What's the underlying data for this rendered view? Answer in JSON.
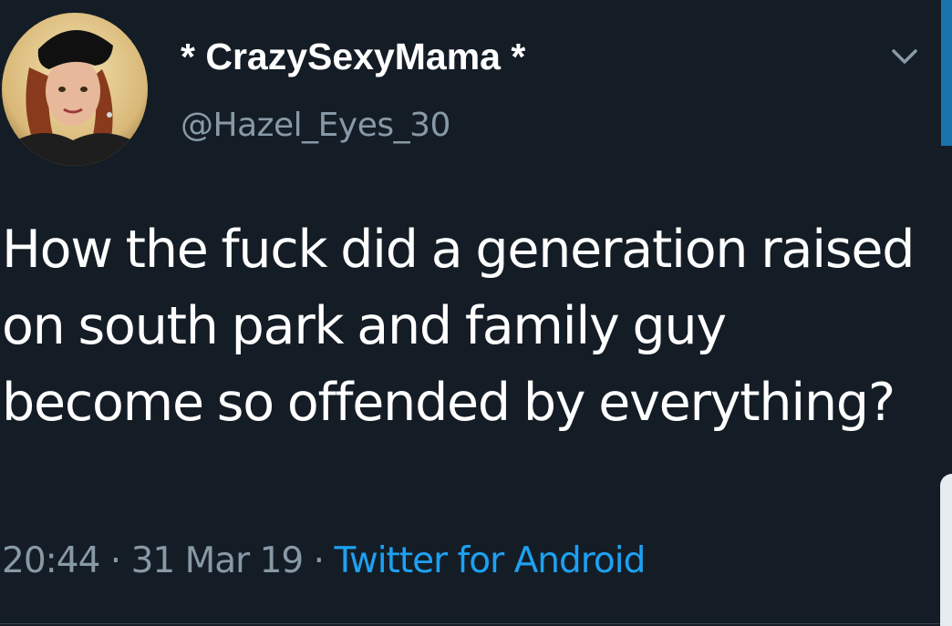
{
  "author": {
    "display_name": "* CrazySexyMama *",
    "handle": "@Hazel_Eyes_30",
    "avatar_icon": "user-avatar-photo"
  },
  "tweet": {
    "text": "How the fuck did a generation raised on south park and family guy become so offended by everything?",
    "time": "20:44",
    "separator": " · ",
    "date": "31 Mar 19",
    "source": "Twitter for Android"
  },
  "icons": {
    "menu": "chevron-down-icon"
  },
  "colors": {
    "background": "#141d26",
    "text_primary": "#ffffff",
    "text_secondary": "#8899a6",
    "accent": "#1da1f2"
  }
}
